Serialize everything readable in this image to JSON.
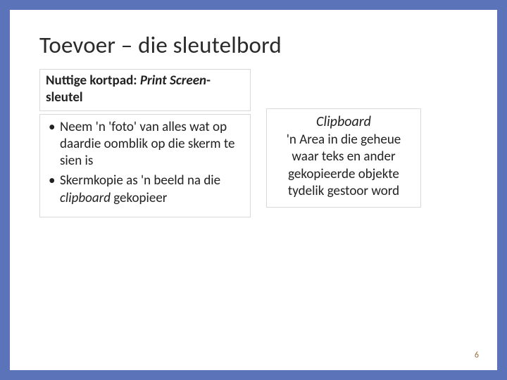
{
  "title": "Toevoer – die sleutelbord",
  "subhead": {
    "bold_prefix": "Nuttige kortpad: ",
    "italic_part": "Print Screen",
    "bold_suffix_line2": "sleutel"
  },
  "bullets": [
    {
      "text": "Neem 'n 'foto' van alles wat op daardie oomblik op die skerm te sien is"
    },
    {
      "text_before": "Skermkopie as 'n beeld na die ",
      "italic": "clipboard",
      "text_after": " gekopieer"
    }
  ],
  "callout": {
    "title": "Clipboard",
    "body": "'n Area in die geheue waar teks en ander gekopieerde objekte tydelik gestoor word"
  },
  "page_number": "6"
}
